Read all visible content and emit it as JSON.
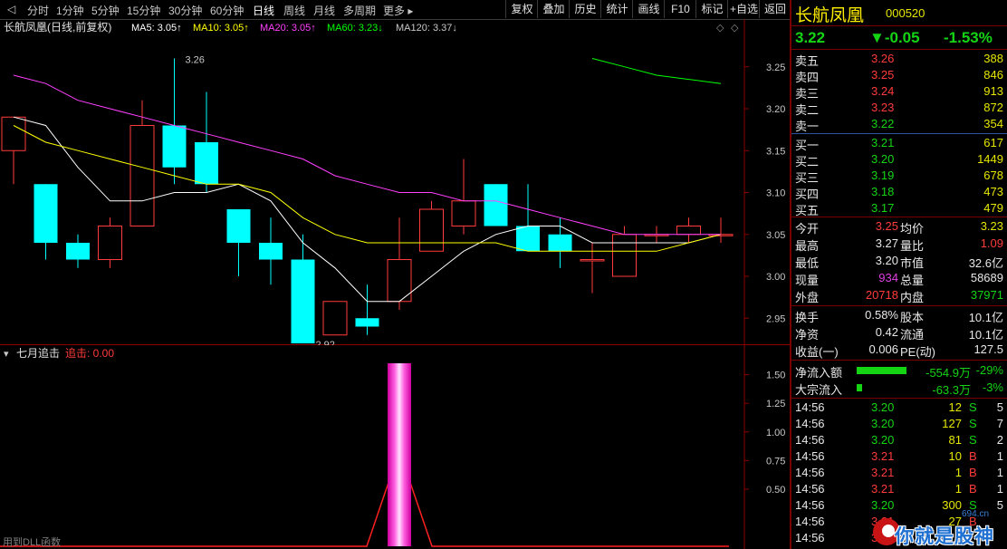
{
  "toolbar": {
    "periods": [
      "分时",
      "1分钟",
      "5分钟",
      "15分钟",
      "30分钟",
      "60分钟",
      "日线",
      "周线",
      "月线",
      "多周期",
      "更多"
    ],
    "active_period": "日线",
    "buttons": [
      "复权",
      "叠加",
      "历史",
      "统计",
      "画线",
      "F10",
      "标记",
      "+自选",
      "返回"
    ]
  },
  "main_chart": {
    "title": "长航凤凰(日线,前复权)",
    "ma_labels": [
      {
        "text": "MA5: 3.05↑",
        "color": "#ffffff"
      },
      {
        "text": "MA10: 3.05↑",
        "color": "#ffff00"
      },
      {
        "text": "MA20: 3.05↑",
        "color": "#ff40ff"
      },
      {
        "text": "MA60: 3.23↓",
        "color": "#00ff00"
      },
      {
        "text": "MA120: 3.37↓",
        "color": "#c8c8c8"
      }
    ],
    "y_ticks": [
      "3.25",
      "3.20",
      "3.15",
      "3.10",
      "3.05",
      "3.00",
      "2.95"
    ],
    "high_label": "3.26",
    "low_label": "2.92"
  },
  "indicator": {
    "title": "七月追击",
    "value_label": "追击: 0.00",
    "y_ticks": [
      "1.50",
      "1.25",
      "1.00",
      "0.75",
      "0.50"
    ],
    "footer": "用到DLL函数"
  },
  "chart_data": {
    "type": "candlestick",
    "ylim": [
      2.92,
      3.28
    ],
    "candles": [
      {
        "open": 3.15,
        "high": 3.19,
        "low": 3.11,
        "close": 3.19
      },
      {
        "open": 3.11,
        "high": 3.11,
        "low": 3.02,
        "close": 3.04
      },
      {
        "open": 3.04,
        "high": 3.05,
        "low": 3.01,
        "close": 3.02
      },
      {
        "open": 3.02,
        "high": 3.07,
        "low": 3.01,
        "close": 3.06
      },
      {
        "open": 3.06,
        "high": 3.21,
        "low": 3.06,
        "close": 3.18
      },
      {
        "open": 3.18,
        "high": 3.26,
        "low": 3.11,
        "close": 3.13
      },
      {
        "open": 3.16,
        "high": 3.22,
        "low": 3.1,
        "close": 3.11
      },
      {
        "open": 3.08,
        "high": 3.08,
        "low": 3.0,
        "close": 3.04
      },
      {
        "open": 3.04,
        "high": 3.07,
        "low": 2.99,
        "close": 3.02
      },
      {
        "open": 3.02,
        "high": 3.05,
        "low": 2.92,
        "close": 2.92
      },
      {
        "open": 2.93,
        "high": 2.97,
        "low": 2.93,
        "close": 2.97
      },
      {
        "open": 2.95,
        "high": 2.99,
        "low": 2.93,
        "close": 2.94
      },
      {
        "open": 2.97,
        "high": 3.07,
        "low": 2.96,
        "close": 3.02
      },
      {
        "open": 3.03,
        "high": 3.09,
        "low": 3.03,
        "close": 3.08
      },
      {
        "open": 3.06,
        "high": 3.14,
        "low": 3.05,
        "close": 3.09
      },
      {
        "open": 3.11,
        "high": 3.11,
        "low": 3.06,
        "close": 3.06
      },
      {
        "open": 3.06,
        "high": 3.11,
        "low": 3.03,
        "close": 3.03
      },
      {
        "open": 3.05,
        "high": 3.07,
        "low": 3.01,
        "close": 3.03
      },
      {
        "open": 3.02,
        "high": 3.04,
        "low": 2.98,
        "close": 3.02
      },
      {
        "open": 3.0,
        "high": 3.06,
        "low": 3.0,
        "close": 3.05
      },
      {
        "open": 3.05,
        "high": 3.06,
        "low": 3.04,
        "close": 3.05
      },
      {
        "open": 3.05,
        "high": 3.07,
        "low": 3.04,
        "close": 3.06
      },
      {
        "open": 3.05,
        "high": 3.07,
        "low": 3.04,
        "close": 3.05
      }
    ],
    "series": [
      {
        "name": "MA5",
        "color": "#ffffff",
        "values": [
          3.19,
          3.18,
          3.13,
          3.09,
          3.09,
          3.1,
          3.1,
          3.11,
          3.09,
          3.04,
          3.01,
          2.97,
          2.97,
          3.0,
          3.03,
          3.05,
          3.06,
          3.06,
          3.04,
          3.04,
          3.04,
          3.04,
          3.05
        ]
      },
      {
        "name": "MA10",
        "color": "#ffff00",
        "values": [
          3.18,
          3.16,
          3.15,
          3.14,
          3.13,
          3.12,
          3.11,
          3.11,
          3.1,
          3.07,
          3.05,
          3.04,
          3.04,
          3.04,
          3.04,
          3.04,
          3.03,
          3.03,
          3.03,
          3.03,
          3.03,
          3.04,
          3.05
        ]
      },
      {
        "name": "MA20",
        "color": "#ff40ff",
        "values": [
          3.24,
          3.23,
          3.21,
          3.2,
          3.19,
          3.18,
          3.17,
          3.16,
          3.15,
          3.14,
          3.12,
          3.11,
          3.1,
          3.1,
          3.09,
          3.09,
          3.08,
          3.07,
          3.06,
          3.05,
          3.05,
          3.05,
          3.05
        ]
      },
      {
        "name": "MA60",
        "color": "#00ff00",
        "values": [
          null,
          null,
          null,
          null,
          null,
          null,
          null,
          null,
          null,
          null,
          null,
          null,
          null,
          null,
          null,
          null,
          null,
          null,
          3.26,
          3.25,
          3.24,
          3.235,
          3.23
        ]
      }
    ],
    "signal": {
      "ylim": [
        0,
        1.6
      ],
      "peak_index": 12,
      "peak_value": 1.6
    }
  },
  "quote": {
    "name": "长航凤凰",
    "code": "000520",
    "price": "3.22",
    "change": "▼-0.05",
    "pct": "-1.53%",
    "asks": [
      {
        "label": "卖五",
        "price": "3.26",
        "vol": "388"
      },
      {
        "label": "卖四",
        "price": "3.25",
        "vol": "846"
      },
      {
        "label": "卖三",
        "price": "3.24",
        "vol": "913"
      },
      {
        "label": "卖二",
        "price": "3.23",
        "vol": "872"
      },
      {
        "label": "卖一",
        "price": "3.22",
        "vol": "354"
      }
    ],
    "bids": [
      {
        "label": "买一",
        "price": "3.21",
        "vol": "617"
      },
      {
        "label": "买二",
        "price": "3.20",
        "vol": "1449"
      },
      {
        "label": "买三",
        "price": "3.19",
        "vol": "678"
      },
      {
        "label": "买四",
        "price": "3.18",
        "vol": "473"
      },
      {
        "label": "买五",
        "price": "3.17",
        "vol": "479"
      }
    ],
    "stats": [
      {
        "l1": "今开",
        "v1": "3.25",
        "c1": "red",
        "l2": "均价",
        "v2": "3.23",
        "c2": "yellow"
      },
      {
        "l1": "最高",
        "v1": "3.27",
        "c1": "white",
        "l2": "量比",
        "v2": "1.09",
        "c2": "red"
      },
      {
        "l1": "最低",
        "v1": "3.20",
        "c1": "white",
        "l2": "市值",
        "v2": "32.6亿",
        "c2": "white"
      },
      {
        "l1": "现量",
        "v1": "934",
        "c1": "magenta",
        "l2": "总量",
        "v2": "58689",
        "c2": "white"
      },
      {
        "l1": "外盘",
        "v1": "20718",
        "c1": "red",
        "l2": "内盘",
        "v2": "37971",
        "c2": "green"
      }
    ],
    "fundamentals": [
      {
        "l1": "换手",
        "v1": "0.58%",
        "l2": "股本",
        "v2": "10.1亿"
      },
      {
        "l1": "净资",
        "v1": "0.42",
        "l2": "流通",
        "v2": "10.1亿"
      },
      {
        "l1": "收益(一)",
        "v1": "0.006",
        "l2": "PE(动)",
        "v2": "127.5"
      }
    ],
    "flows": [
      {
        "label": "净流入额",
        "amount": "-554.9万",
        "pct": "-29%",
        "level": 0.29
      },
      {
        "label": "大宗流入",
        "amount": "-63.3万",
        "pct": "-3%",
        "level": 0.03
      }
    ],
    "ticks": [
      {
        "time": "14:56",
        "price": "3.20",
        "vol": "12",
        "side": "S",
        "n": "5"
      },
      {
        "time": "14:56",
        "price": "3.20",
        "vol": "127",
        "side": "S",
        "n": "7"
      },
      {
        "time": "14:56",
        "price": "3.20",
        "vol": "81",
        "side": "S",
        "n": "2"
      },
      {
        "time": "14:56",
        "price": "3.21",
        "vol": "10",
        "side": "B",
        "n": "1"
      },
      {
        "time": "14:56",
        "price": "3.21",
        "vol": "1",
        "side": "B",
        "n": "1"
      },
      {
        "time": "14:56",
        "price": "3.21",
        "vol": "1",
        "side": "B",
        "n": "1"
      },
      {
        "time": "14:56",
        "price": "3.20",
        "vol": "300",
        "side": "S",
        "n": "5"
      },
      {
        "time": "14:56",
        "price": "3.21",
        "vol": "27",
        "side": "B",
        "n": ""
      },
      {
        "time": "14:56",
        "price": "3.21",
        "vol": "",
        "side": "",
        "n": ""
      }
    ]
  },
  "watermark": {
    "text": "你就是股神",
    "site": "694.cn"
  },
  "colors": {
    "up": "#ff3b3b",
    "down": "#00ffff",
    "bg": "#000000",
    "border": "#7a0000",
    "axis_red": "#8b0000"
  }
}
